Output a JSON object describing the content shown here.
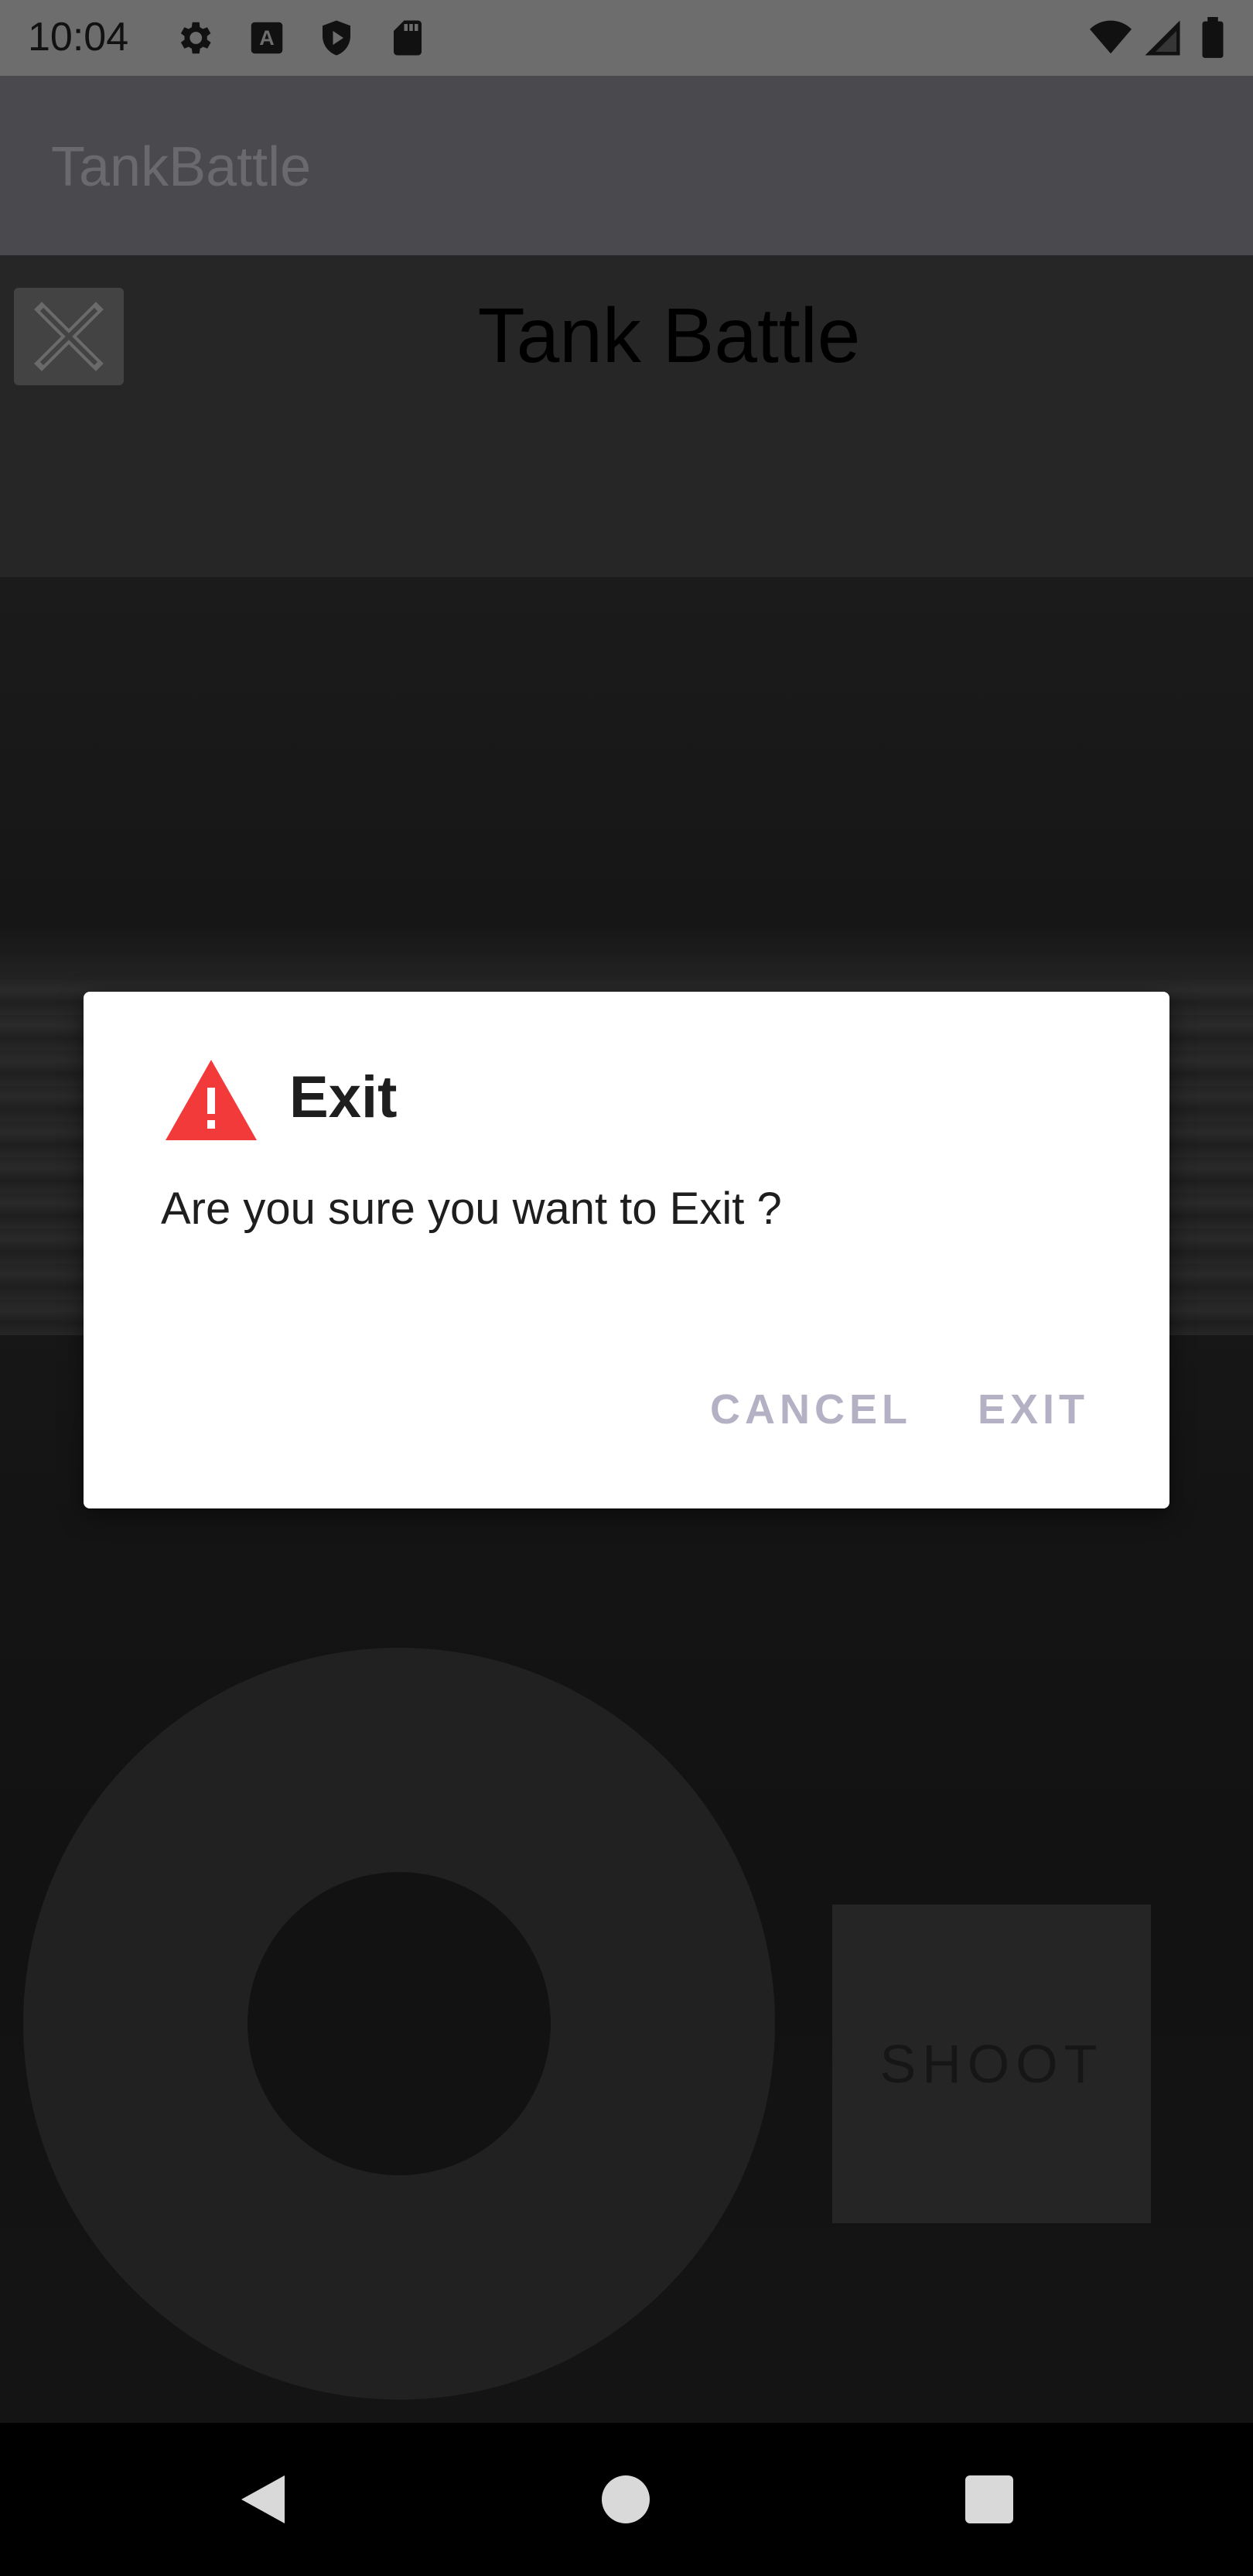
{
  "status_bar": {
    "time": "10:04",
    "left_icons": [
      "gear-icon",
      "text-a-icon",
      "shield-play-icon",
      "sd-card-icon"
    ],
    "right_icons": [
      "wifi-icon",
      "signal-icon",
      "battery-icon"
    ]
  },
  "app_bar": {
    "title": "TankBattle"
  },
  "game": {
    "title": "Tank Battle",
    "close_icon": "close-icon",
    "shoot_label": "SHOOT"
  },
  "dialog": {
    "icon": "warning-icon",
    "title": "Exit",
    "message": "Are you sure you want to Exit ?",
    "cancel_label": "CANCEL",
    "exit_label": "EXIT"
  },
  "nav_bar": {
    "icons": [
      "back-icon",
      "home-icon",
      "recents-icon"
    ]
  },
  "colors": {
    "warning": "#f33a3a",
    "dialog_button_text": "#b3b1c3",
    "app_bar": "#4a494d",
    "status_bar": "#6d6d6d"
  }
}
